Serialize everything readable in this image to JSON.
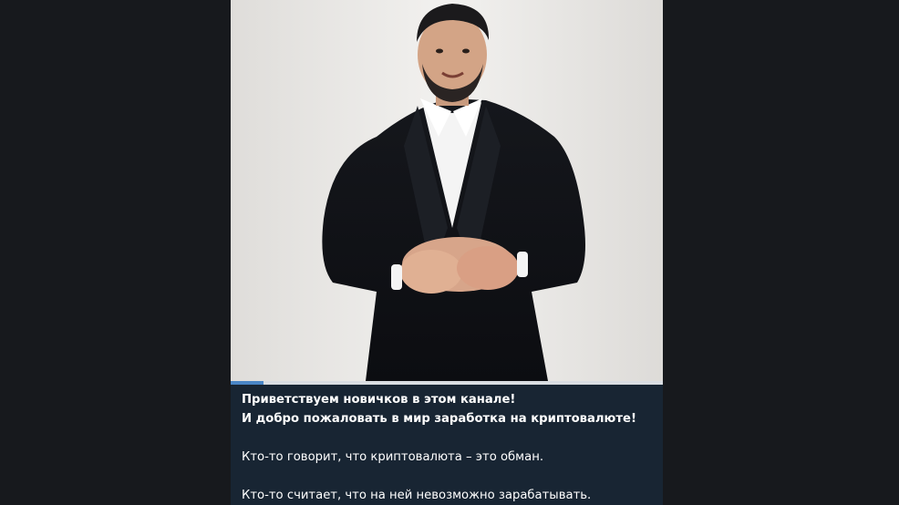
{
  "video": {
    "progress": 0.075
  },
  "caption": {
    "line1": "Приветствуем новичков в этом канале!",
    "line2": "И добро пожаловать в мир заработка на криптовалюте!",
    "line3": "Кто-то говорит, что криптовалюта – это обман.",
    "line4": "Кто-то считает, что на ней невозможно зарабатывать."
  },
  "colors": {
    "background": "#17191d",
    "message_bubble": "#182533",
    "progress_accent": "#4a86c6",
    "text": "#ffffff"
  }
}
